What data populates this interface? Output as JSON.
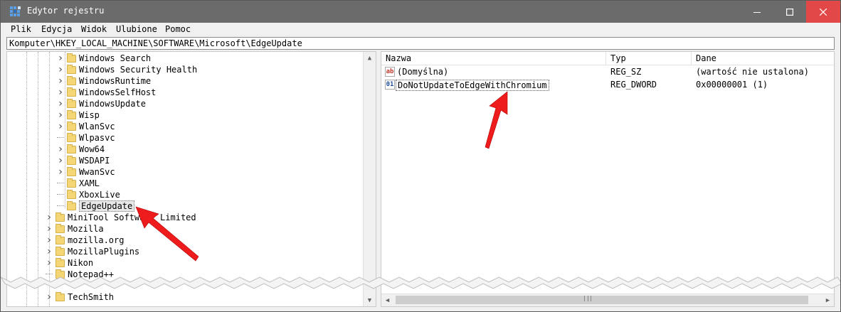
{
  "window": {
    "title": "Edytor rejestru",
    "minimize_glyph": "—",
    "maximize_glyph": "☐",
    "close_glyph": "✕",
    "icon": "registry-editor-icon"
  },
  "menu": {
    "items": [
      "Plik",
      "Edycja",
      "Widok",
      "Ulubione",
      "Pomoc"
    ]
  },
  "address": {
    "path": "Komputer\\HKEY_LOCAL_MACHINE\\SOFTWARE\\Microsoft\\EdgeUpdate"
  },
  "tree": {
    "items": [
      {
        "label": "Windows Search",
        "expandable": true
      },
      {
        "label": "Windows Security Health",
        "expandable": true
      },
      {
        "label": "WindowsRuntime",
        "expandable": true
      },
      {
        "label": "WindowsSelfHost",
        "expandable": true
      },
      {
        "label": "WindowsUpdate",
        "expandable": true
      },
      {
        "label": "Wisp",
        "expandable": true
      },
      {
        "label": "WlanSvc",
        "expandable": true
      },
      {
        "label": "Wlpasvc",
        "expandable": false
      },
      {
        "label": "Wow64",
        "expandable": true
      },
      {
        "label": "WSDAPI",
        "expandable": true
      },
      {
        "label": "WwanSvc",
        "expandable": true
      },
      {
        "label": "XAML",
        "expandable": false
      },
      {
        "label": "XboxLive",
        "expandable": false
      },
      {
        "label": "EdgeUpdate",
        "expandable": false,
        "selected": true
      }
    ],
    "parent_items": [
      {
        "label": "MiniTool Software Limited",
        "expandable": true
      },
      {
        "label": "Mozilla",
        "expandable": true
      },
      {
        "label": "mozilla.org",
        "expandable": true
      },
      {
        "label": "MozillaPlugins",
        "expandable": true
      },
      {
        "label": "Nikon",
        "expandable": true
      },
      {
        "label": "Notepad++",
        "expandable": false
      },
      {
        "label": "TechSmith",
        "expandable": true
      }
    ]
  },
  "values": {
    "columns": [
      "Nazwa",
      "Typ",
      "Dane"
    ],
    "rows": [
      {
        "name": "(Domyślna)",
        "type": "REG_SZ",
        "data": "(wartość nie ustalona)",
        "icon": "string-value-icon",
        "icon_glyph": "ab"
      },
      {
        "name": "DoNotUpdateToEdgeWithChromium",
        "type": "REG_DWORD",
        "data": "0x00000001 (1)",
        "icon": "binary-value-icon",
        "icon_glyph": "01",
        "selected": true
      }
    ]
  },
  "colors": {
    "titlebar": "#6b6b6b",
    "close_button": "#e34848",
    "folder": "#f5d676",
    "annotation_arrow": "#ee1c1c"
  }
}
